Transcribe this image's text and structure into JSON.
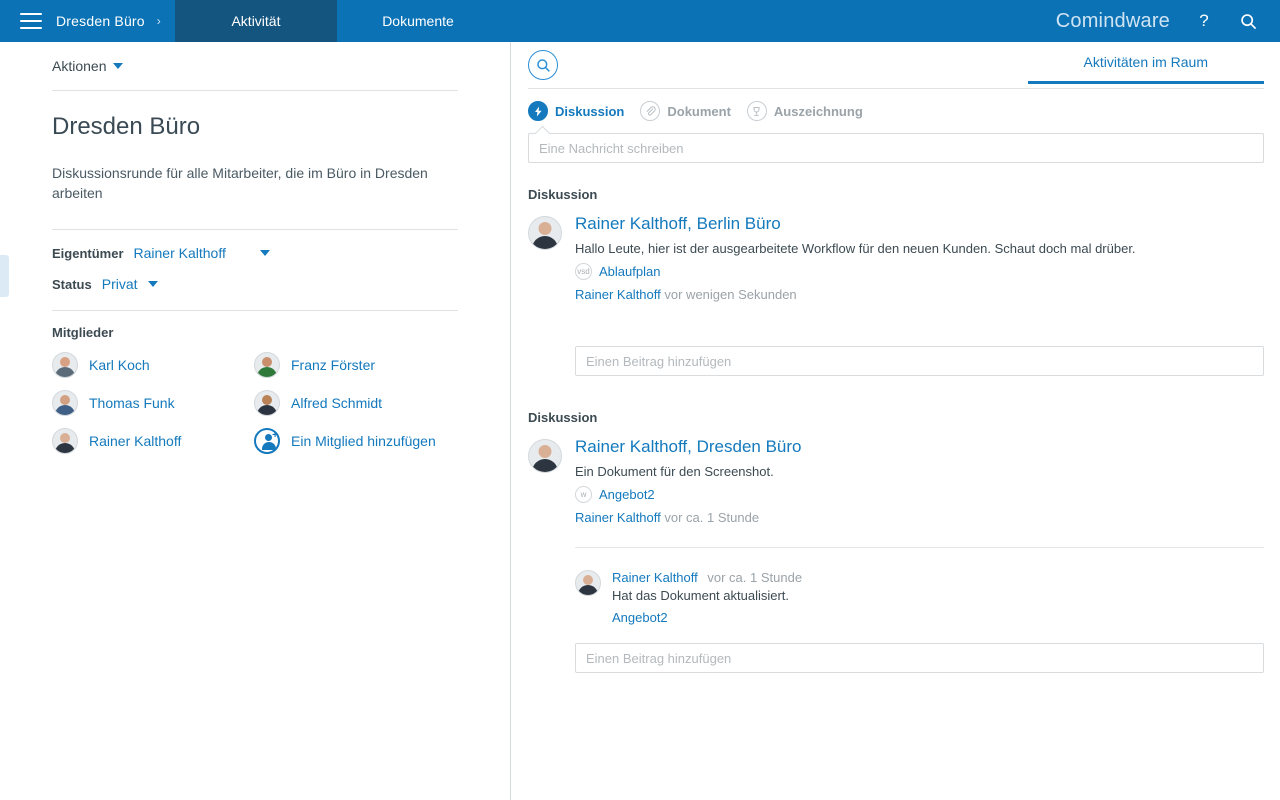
{
  "topbar": {
    "menu_icon": "hamburger-icon",
    "breadcrumb": "Dresden Büro",
    "breadcrumb_sep": "›",
    "tabs": [
      {
        "label": "Aktivität",
        "active": true
      },
      {
        "label": "Dokumente",
        "active": false
      }
    ],
    "logo": "Comindware",
    "help_icon": "?",
    "search_icon": "search-icon",
    "bg_color": "#0b72b5",
    "active_tab_color": "#14557f"
  },
  "left": {
    "actions_label": "Aktionen",
    "title": "Dresden Büro",
    "description": "Diskussionsrunde für alle Mitarbeiter, die im Büro in Dresden arbeiten",
    "owner_label": "Eigentümer",
    "owner_value": "Rainer Kalthoff",
    "status_label": "Status",
    "status_value": "Privat",
    "members_label": "Mitglieder",
    "members": [
      {
        "name": "Karl Koch",
        "skin": "#d8a183",
        "cloth": "#5b6b7a"
      },
      {
        "name": "Franz Förster",
        "skin": "#c98f6c",
        "cloth": "#2f7a3a"
      },
      {
        "name": "Thomas Funk",
        "skin": "#d2a184",
        "cloth": "#3f5f86"
      },
      {
        "name": "Alfred Schmidt",
        "skin": "#b98257",
        "cloth": "#2b3440"
      },
      {
        "name": "Rainer Kalthoff",
        "skin": "#d9b096",
        "cloth": "#2d3640"
      }
    ],
    "add_member_label": "Ein Mitglied hinzufügen"
  },
  "right": {
    "search_icon": "search-icon",
    "tabs": [
      {
        "label": "Aktivitäten im Raum",
        "active": true
      }
    ],
    "filters": [
      {
        "label": "Diskussion",
        "icon": "chat-bolt-icon",
        "glyph": "⚡",
        "active": true
      },
      {
        "label": "Dokument",
        "icon": "paperclip-icon",
        "glyph": "🖇",
        "active": false
      },
      {
        "label": "Auszeichnung",
        "icon": "trophy-icon",
        "glyph": "♕",
        "active": false
      }
    ],
    "message_placeholder": "Eine Nachricht schreiben",
    "threads": [
      {
        "section_label": "Diskussion",
        "author": "Rainer Kalthoff",
        "context": "Berlin Büro",
        "body": "Hallo Leute, hier ist der ausgearbeitete Workflow für den neuen Kunden. Schaut doch mal drüber.",
        "attachment": {
          "name": "Ablaufplan",
          "badge": "vsd"
        },
        "meta_author": "Rainer Kalthoff",
        "meta_time": "vor wenigen Sekunden",
        "comment_placeholder": "Einen Beitrag hinzufügen",
        "replies": []
      },
      {
        "section_label": "Diskussion",
        "author": "Rainer Kalthoff",
        "context": "Dresden Büro",
        "body": "Ein Dokument für den Screenshot.",
        "attachment": {
          "name": "Angebot2",
          "badge": "w"
        },
        "meta_author": "Rainer Kalthoff",
        "meta_time": "vor ca. 1 Stunde",
        "comment_placeholder": "Einen Beitrag hinzufügen",
        "replies": [
          {
            "author": "Rainer Kalthoff",
            "time": "vor ca. 1 Stunde",
            "text": "Hat das Dokument aktualisiert.",
            "link": "Angebot2"
          }
        ]
      }
    ]
  }
}
